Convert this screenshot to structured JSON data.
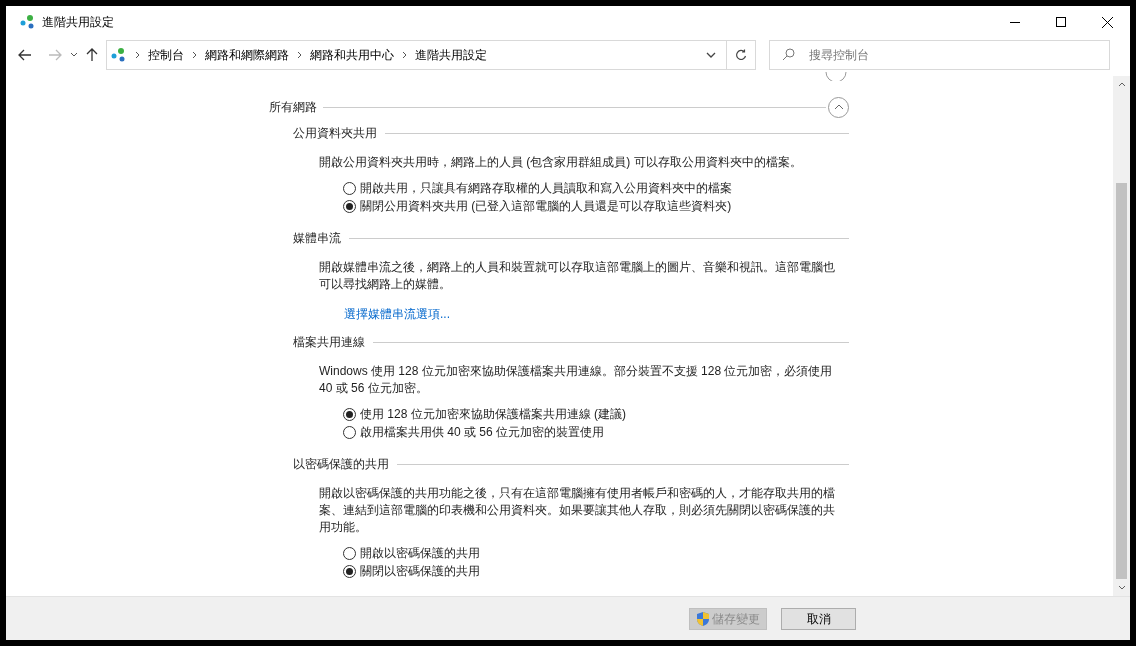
{
  "window": {
    "title": "進階共用設定"
  },
  "address_bar": {
    "breadcrumbs": [
      "控制台",
      "網路和網際網路",
      "網路和共用中心",
      "進階共用設定"
    ]
  },
  "search": {
    "placeholder": "搜尋控制台"
  },
  "group": {
    "title": "所有網路",
    "expanded": true,
    "sections": [
      {
        "kind": "radios",
        "title": "公用資料夾共用",
        "description": "開啟公用資料夾共用時，網路上的人員 (包含家用群組成員) 可以存取公用資料夾中的檔案。",
        "options": [
          {
            "label": "開啟共用，只讓具有網路存取權的人員讀取和寫入公用資料夾中的檔案",
            "selected": false
          },
          {
            "label": "關閉公用資料夾共用 (已登入這部電腦的人員還是可以存取這些資料夾)",
            "selected": true
          }
        ]
      },
      {
        "kind": "link",
        "title": "媒體串流",
        "description": "開啟媒體串流之後，網路上的人員和裝置就可以存取這部電腦上的圖片、音樂和視訊。這部電腦也可以尋找網路上的媒體。",
        "link": "選擇媒體串流選項..."
      },
      {
        "kind": "radios",
        "title": "檔案共用連線",
        "description": "Windows 使用 128 位元加密來協助保護檔案共用連線。部分裝置不支援 128 位元加密，必須使用 40 或 56 位元加密。",
        "options": [
          {
            "label": "使用 128 位元加密來協助保護檔案共用連線 (建議)",
            "selected": true
          },
          {
            "label": "啟用檔案共用供 40 或 56 位元加密的裝置使用",
            "selected": false
          }
        ]
      },
      {
        "kind": "radios",
        "title": "以密碼保護的共用",
        "description": "開啟以密碼保護的共用功能之後，只有在這部電腦擁有使用者帳戶和密碼的人，才能存取共用的檔案、連結到這部電腦的印表機和公用資料夾。如果要讓其他人存取，則必須先關閉以密碼保護的共用功能。",
        "options": [
          {
            "label": "開啟以密碼保護的共用",
            "selected": false
          },
          {
            "label": "關閉以密碼保護的共用",
            "selected": true
          }
        ]
      }
    ]
  },
  "footer": {
    "buttons": [
      {
        "label": "儲存變更",
        "disabled": true,
        "shield": true
      },
      {
        "label": "取消",
        "disabled": false,
        "shield": false
      }
    ]
  }
}
